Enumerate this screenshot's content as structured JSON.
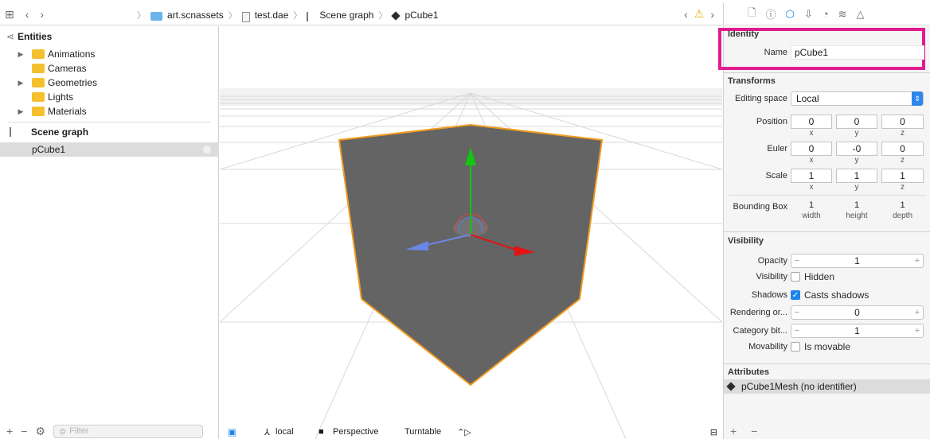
{
  "breadcrumbs": [
    "art.scnassets",
    "test.dae",
    "Scene graph",
    "pCube1"
  ],
  "navigator": {
    "entities_header": "Entities",
    "entities": [
      {
        "label": "Animations",
        "expandable": true
      },
      {
        "label": "Cameras",
        "expandable": false
      },
      {
        "label": "Geometries",
        "expandable": true
      },
      {
        "label": "Lights",
        "expandable": false
      },
      {
        "label": "Materials",
        "expandable": true
      }
    ],
    "scene_graph_header": "Scene graph",
    "selected_node": "pCube1",
    "filter_placeholder": "Filter"
  },
  "viewport": {
    "space": "local",
    "camera": "Perspective",
    "mode": "Turntable"
  },
  "inspector": {
    "identity": {
      "header": "Identity",
      "name_label": "Name",
      "name_value": "pCube1"
    },
    "transforms": {
      "header": "Transforms",
      "editing_space_label": "Editing space",
      "editing_space_value": "Local",
      "position_label": "Position",
      "position": [
        "0",
        "0",
        "0"
      ],
      "euler_label": "Euler",
      "euler": [
        "0",
        "-0",
        "0"
      ],
      "scale_label": "Scale",
      "scale": [
        "1",
        "1",
        "1"
      ],
      "axis_labels": [
        "x",
        "y",
        "z"
      ],
      "bbox_label": "Bounding Box",
      "bbox_values": [
        "1",
        "1",
        "1"
      ],
      "bbox_labels": [
        "width",
        "height",
        "depth"
      ]
    },
    "visibility": {
      "header": "Visibility",
      "opacity_label": "Opacity",
      "opacity_value": "1",
      "visibility_label": "Visibility",
      "hidden_label": "Hidden",
      "shadows_label": "Shadows",
      "casts_shadows_label": "Casts shadows",
      "rendering_order_label": "Rendering or...",
      "rendering_order_value": "0",
      "category_label": "Category bit...",
      "category_value": "1",
      "movability_label": "Movability",
      "movable_label": "Is movable",
      "stepper_minus": "−",
      "stepper_plus": "+"
    },
    "attributes": {
      "header": "Attributes",
      "item": "pCube1Mesh (no identifier)"
    }
  },
  "colors": {
    "accent": "#1f84ea",
    "highlight": "#e21b8f",
    "cube_fill": "#646464",
    "cube_edge": "#f09a1e"
  }
}
